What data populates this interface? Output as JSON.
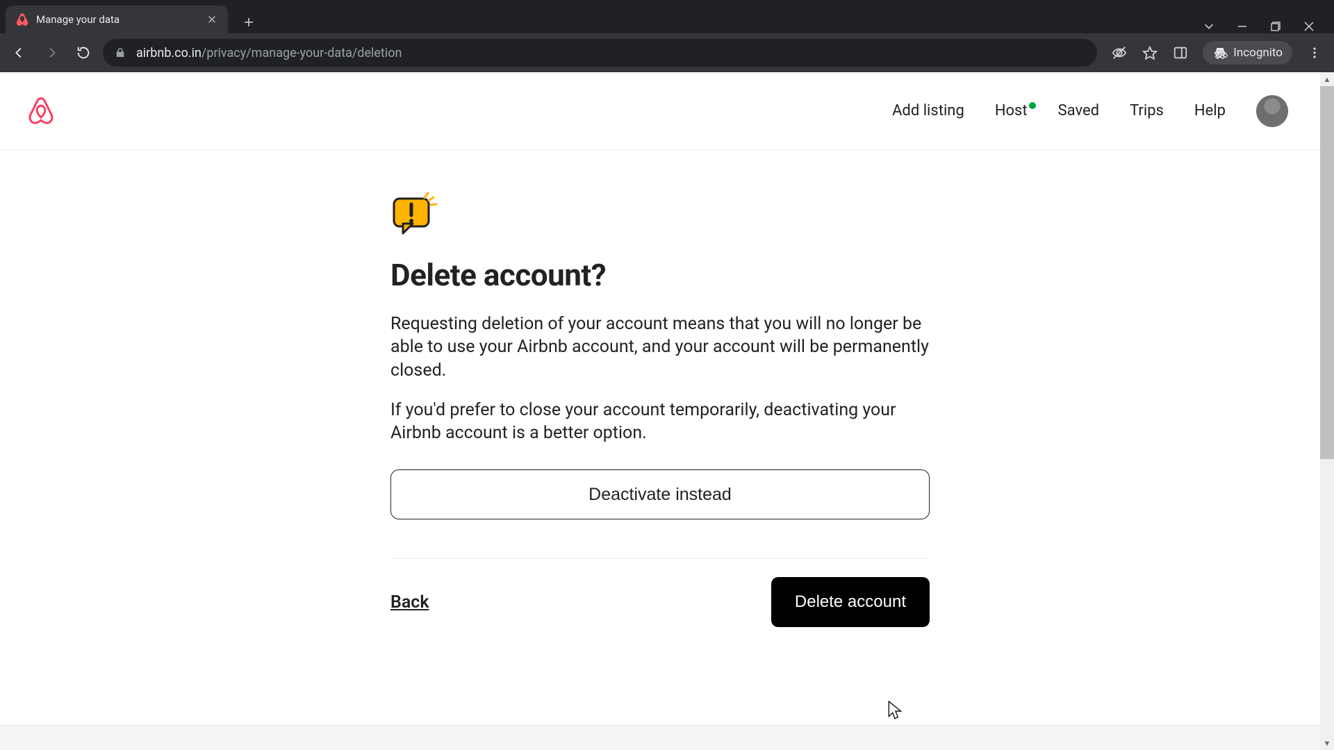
{
  "browser": {
    "tab_title": "Manage your data",
    "url_host": "airbnb.co.in",
    "url_path": "/privacy/manage-your-data/deletion",
    "incognito_label": "Incognito"
  },
  "nav": {
    "add_listing": "Add listing",
    "host": "Host",
    "saved": "Saved",
    "trips": "Trips",
    "help": "Help"
  },
  "content": {
    "heading": "Delete account?",
    "para1": "Requesting deletion of your account means that you will no longer be able to use your Airbnb account, and your account will be permanently closed.",
    "para2": "If you'd prefer to close your account temporarily, deactivating your Airbnb account is a better option.",
    "deactivate_label": "Deactivate instead",
    "back_label": "Back",
    "delete_label": "Delete account"
  },
  "colors": {
    "brand": "#FF385C",
    "primary_btn_bg": "#000000",
    "status_dot": "#00a646",
    "warn_fill": "#FFB400"
  }
}
